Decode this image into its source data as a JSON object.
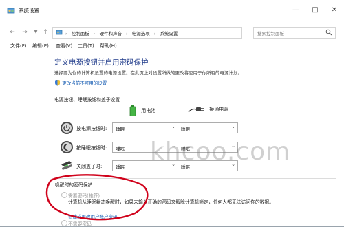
{
  "window": {
    "title": "系统设置"
  },
  "address": {
    "crumbs": [
      "控制面板",
      "硬件和声音",
      "电源选项",
      "系统设置"
    ]
  },
  "search": {
    "placeholder": "搜索控制面板"
  },
  "menu": [
    "文件(F)",
    "编辑(E)",
    "查看(V)",
    "工具(T)",
    "帮助(H)"
  ],
  "page": {
    "title": "定义电源按钮并启用密码保护",
    "description": "选择要为你的计算机设置的电源设置。在此页上对设置所做的更改将应用于你所有的电源计划。",
    "change_unavailable_link": "更改当前不可用的设置"
  },
  "buttons_section": {
    "label": "电源按钮、睡眠按钮和盖子设置",
    "on_battery": "用电池",
    "plugged_in": "接通电源",
    "rows": [
      {
        "label": "按电源按钮时:",
        "battery": "睡眠",
        "ac": "睡眠",
        "icon": "power-button-icon"
      },
      {
        "label": "按睡眠按钮时:",
        "battery": "睡眠",
        "ac": "睡眠",
        "icon": "sleep-button-icon"
      },
      {
        "label": "关闭盖子时:",
        "battery": "睡眠",
        "ac": "睡眠",
        "icon": "laptop-lid-icon"
      }
    ]
  },
  "wake_password": {
    "title": "唤醒时的密码保护",
    "require_option": "需要密码(推荐)",
    "require_description": "计算机从睡眠状态唤醒时，如果未输入正确的密码来解除计算机锁定，任何人都无法访问你的数据。",
    "create_link": "创建或更改用户帐户密码",
    "no_require_option": "不需要密码"
  },
  "watermark": "khcoo.com",
  "colors": {
    "title_blue": "#1e3a8a",
    "link_blue": "#1a5fb4",
    "annotation_red": "#d0021b"
  }
}
